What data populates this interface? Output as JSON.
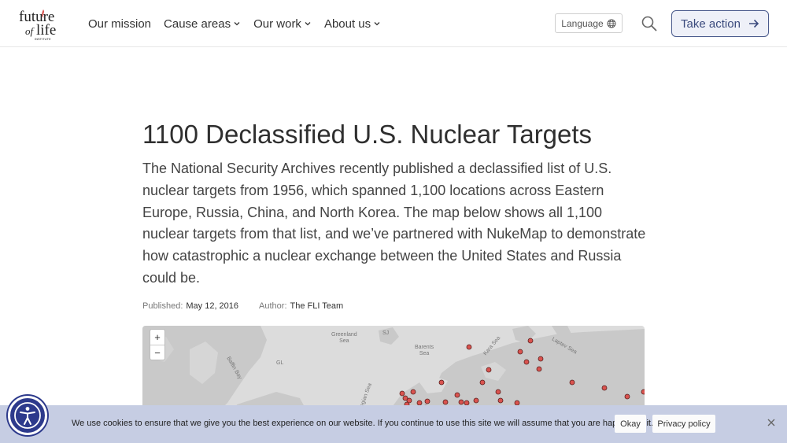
{
  "header": {
    "logo_alt": "Future of Life Institute",
    "nav": [
      {
        "label": "Our mission",
        "has_dropdown": false
      },
      {
        "label": "Cause areas",
        "has_dropdown": true
      },
      {
        "label": "Our work",
        "has_dropdown": true
      },
      {
        "label": "About us",
        "has_dropdown": true
      }
    ],
    "language_label": "Language",
    "cta_label": "Take action"
  },
  "article": {
    "title": "1100 Declassified U.S. Nuclear Targets",
    "intro": "The National Security Archives recently published a declassified list of U.S. nuclear targets from 1956, which spanned 1,100 locations across Eastern Europe, Russia, China, and North Korea. The map below shows all 1,100 nuclear targets from that list, and we’ve partnered with NukeMap to demonstrate how catastrophic a nuclear exchange between the United States and Russia could be.",
    "published_label": "Published:",
    "published_value": "May 12, 2016",
    "author_label": "Author:",
    "author_value": "The FLI Team"
  },
  "map": {
    "zoom_in": "+",
    "zoom_out": "−",
    "labels": {
      "greenland_sea": "Greenland\nSea",
      "sj": "SJ",
      "barents_sea": "Barents\nSea",
      "kara_sea": "Kara Sea",
      "laptev_sea": "Laptev Sea",
      "baffin_bay": "Baffin Bay",
      "gl": "GL",
      "norwegian_sea": "Norwegian Sea"
    },
    "colors": {
      "land": "#c9c9c9",
      "water": "#dcdcdc",
      "target": "#d9534f"
    }
  },
  "cookie": {
    "message": "We use cookies to ensure that we give you the best experience on our website. If you continue to use this site we will assume that you are happy with it.",
    "ok_label": "Okay",
    "policy_label": "Privacy policy"
  },
  "icons": {
    "language": "globe-icon",
    "search": "search-icon",
    "cta": "arrow-right-icon",
    "close": "close-icon",
    "accessibility": "accessibility-icon"
  }
}
